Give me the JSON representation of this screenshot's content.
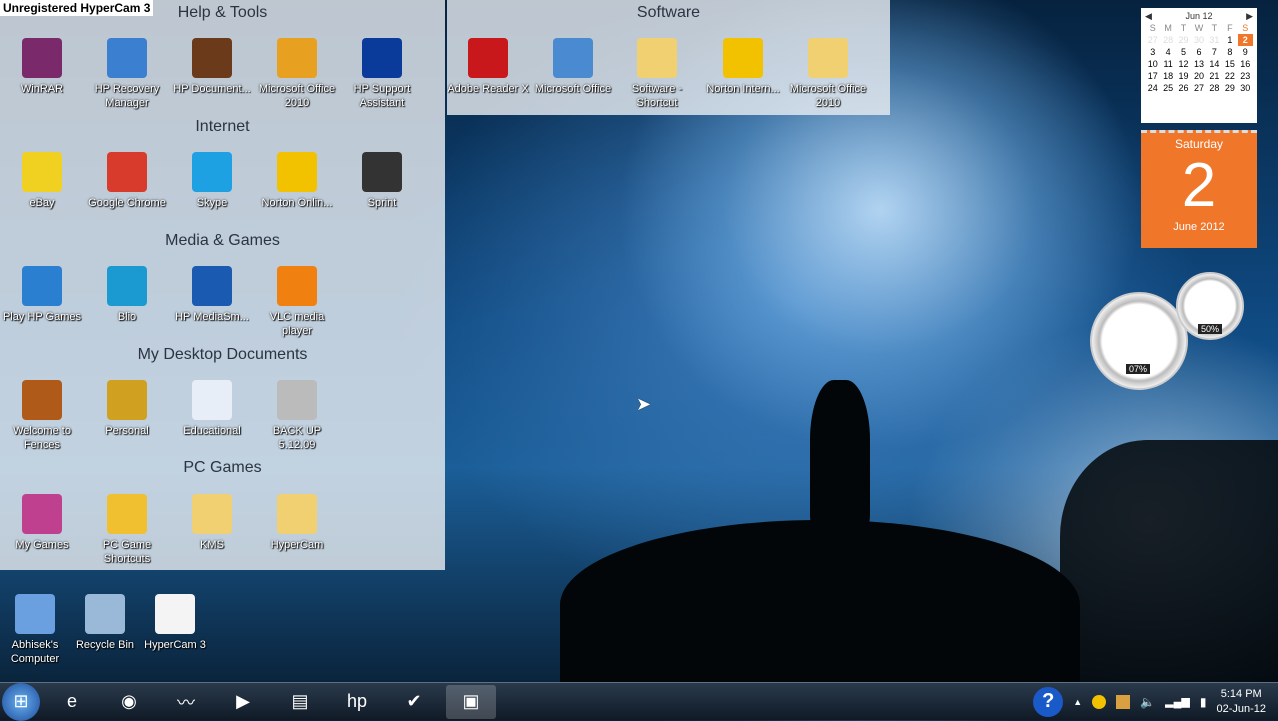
{
  "watermark": "Unregistered HyperCam 3",
  "fences": [
    {
      "title": "Help & Tools",
      "items": [
        {
          "label": "WinRAR",
          "icon": "winrar-icon",
          "color": "#7a2a6b"
        },
        {
          "label": "HP Recovery Manager",
          "icon": "hp-recovery-icon",
          "color": "#3a7fd0"
        },
        {
          "label": "HP Document...",
          "icon": "books-icon",
          "color": "#6b3a1a"
        },
        {
          "label": "Microsoft Office 2010",
          "icon": "office-icon",
          "color": "#e8a020"
        },
        {
          "label": "HP Support Assistant",
          "icon": "help-icon",
          "color": "#0a3a9a"
        }
      ]
    },
    {
      "title": "Internet",
      "items": [
        {
          "label": "eBay",
          "icon": "ebay-icon",
          "color": "#f0d020"
        },
        {
          "label": "Google Chrome",
          "icon": "chrome-icon",
          "color": "#d83b2b"
        },
        {
          "label": "Skype",
          "icon": "skype-icon",
          "color": "#1da1e2"
        },
        {
          "label": "Norton Onlin...",
          "icon": "norton-icon",
          "color": "#f2c200"
        },
        {
          "label": "Sprint",
          "icon": "sprint-icon",
          "color": "#333"
        }
      ]
    },
    {
      "title": "Media & Games",
      "items": [
        {
          "label": "Play HP Games",
          "icon": "hp-games-icon",
          "color": "#2a7fd0"
        },
        {
          "label": "Blio",
          "icon": "blio-icon",
          "color": "#1a9ad0"
        },
        {
          "label": "HP MediaSm...",
          "icon": "mediasmart-icon",
          "color": "#1a5ab0"
        },
        {
          "label": "VLC media player",
          "icon": "vlc-icon",
          "color": "#f08010"
        }
      ]
    },
    {
      "title": "My Desktop Documents",
      "items": [
        {
          "label": "Welcome to Fences",
          "icon": "fences-icon",
          "color": "#b05a1a"
        },
        {
          "label": "Personal",
          "icon": "lock-icon",
          "color": "#d0a020"
        },
        {
          "label": "Educational",
          "icon": "checklist-icon",
          "color": "#e8eef8"
        },
        {
          "label": "BACK UP 5.12.09",
          "icon": "drive-icon",
          "color": "#bbb"
        }
      ]
    },
    {
      "title": "PC Games",
      "items": [
        {
          "label": "My Games",
          "icon": "games-icon",
          "color": "#c04090"
        },
        {
          "label": "PC Game Shortcuts",
          "icon": "folder-star-icon",
          "color": "#f0c030"
        },
        {
          "label": "KMS",
          "icon": "folder-icon",
          "color": "#f0d070"
        },
        {
          "label": "HyperCam",
          "icon": "folder-icon",
          "color": "#f0d070"
        }
      ]
    }
  ],
  "software": {
    "title": "Software",
    "items": [
      {
        "label": "Adobe Reader X",
        "icon": "adobe-icon",
        "color": "#c8181b"
      },
      {
        "label": "Microsoft Office",
        "icon": "computer-icon",
        "color": "#4a8ad0"
      },
      {
        "label": "Software - Shortcut",
        "icon": "folder-icon",
        "color": "#f0d070"
      },
      {
        "label": "Norton Intern...",
        "icon": "globe-icon",
        "color": "#f2c200"
      },
      {
        "label": "Microsoft Office 2010",
        "icon": "folder-icon",
        "color": "#f0d070"
      }
    ]
  },
  "desktop": [
    {
      "label": "Abhisek's Computer",
      "icon": "computer-icon",
      "color": "#6aa0e0"
    },
    {
      "label": "Recycle Bin",
      "icon": "recycle-bin-icon",
      "color": "#9ab8d8"
    },
    {
      "label": "HyperCam 3",
      "icon": "document-icon",
      "color": "#f4f4f4"
    }
  ],
  "calendar": {
    "month": "Jun 12",
    "weekdays": [
      "S",
      "M",
      "T",
      "W",
      "T",
      "F",
      "S"
    ],
    "weeks": [
      [
        "27",
        "28",
        "29",
        "30",
        "31",
        "1",
        "2"
      ],
      [
        "3",
        "4",
        "5",
        "6",
        "7",
        "8",
        "9"
      ],
      [
        "10",
        "11",
        "12",
        "13",
        "14",
        "15",
        "16"
      ],
      [
        "17",
        "18",
        "19",
        "20",
        "21",
        "22",
        "23"
      ],
      [
        "24",
        "25",
        "26",
        "27",
        "28",
        "29",
        "30"
      ]
    ],
    "today": "2",
    "dayname": "Saturday",
    "day": "2",
    "monthyear": "June 2012",
    "accent": "#f0762a"
  },
  "gauges": {
    "cpu": "07%",
    "memory": "50%"
  },
  "tray": {
    "time": "5:14 PM",
    "date": "02-Jun-12"
  },
  "taskbar": [
    {
      "icon": "start-orb-icon",
      "glyph": "⊞"
    },
    {
      "icon": "internet-explorer-icon",
      "glyph": "e"
    },
    {
      "icon": "chrome-icon",
      "glyph": "◉"
    },
    {
      "icon": "mediasmart-icon",
      "glyph": "〰"
    },
    {
      "icon": "media-player-icon",
      "glyph": "▶"
    },
    {
      "icon": "explorer-icon",
      "glyph": "▤"
    },
    {
      "icon": "hp-icon",
      "glyph": "hp"
    },
    {
      "icon": "checkmark-app-icon",
      "glyph": "✔"
    },
    {
      "icon": "hypercam-icon",
      "glyph": "▣"
    }
  ]
}
